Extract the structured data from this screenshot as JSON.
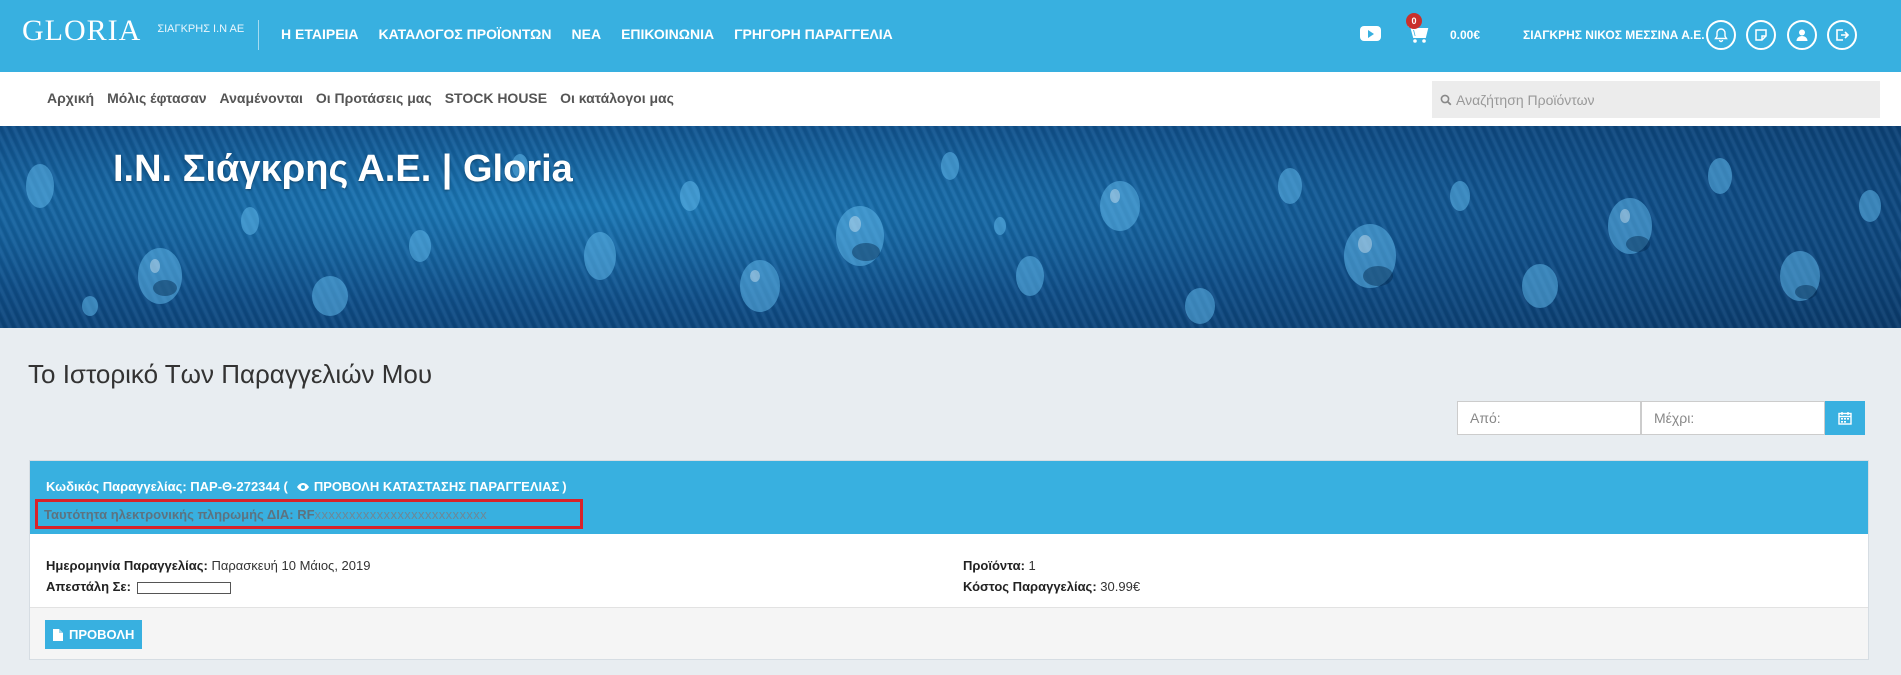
{
  "header": {
    "logo_text": "GLORIA",
    "logo_subtitle": "ΣΙΑΓΚΡΗΣ Ι.Ν ΑΕ",
    "nav": [
      "Η ΕΤΑΙΡΕΙΑ",
      "ΚΑΤΑΛΟΓΟΣ ΠΡΟΪΟΝΤΩΝ",
      "ΝΕΑ",
      "ΕΠΙΚΟΙΝΩΝΙΑ",
      "ΓΡΗΓΟΡΗ ΠΑΡΑΓΓΕΛΙΑ"
    ],
    "cart_count": "0",
    "cart_total": "0.00€",
    "username": "ΣΙΑΓΚΡΗΣ ΝΙΚΟΣ ΜΕΣΣΙΝΑ Α.Ε.",
    "icons": [
      "youtube-icon",
      "cart-icon",
      "bell-icon",
      "note-icon",
      "user-icon",
      "logout-icon"
    ]
  },
  "subnav": {
    "links": [
      "Αρχική",
      "Μόλις έφτασαν",
      "Αναμένονται",
      "Οι Προτάσεις μας",
      "STOCK HOUSE",
      "Οι κατάλογοι μας"
    ],
    "search_placeholder": "Αναζήτηση Προϊόντων"
  },
  "hero": {
    "title": "Ι.Ν. Σιάγκρης Α.Ε. | Gloria"
  },
  "page": {
    "heading": "Το Ιστορικό Των Παραγγελιών Μου",
    "from_placeholder": "Από:",
    "to_placeholder": "Μέχρι:"
  },
  "order": {
    "code_label": "Κωδικός Παραγγελίας: ΠΑΡ-Θ-272344 (",
    "status_link": "ΠΡΟΒΟΛΗ ΚΑΤΑΣΤΑΣΗΣ ΠΑΡΑΓΓΕΛΙΑΣ",
    "close_paren": ")",
    "payment_label": "Ταυτότητα ηλεκτρονικής πληρωμής ΔΙΑ: RF",
    "payment_mask": "xxxxxxxxxxxxxxxxxxxxxxxxx",
    "date_label": "Ημερομηνία Παραγγελίας:",
    "date_value": "Παρασκευή 10 Μάιος, 2019",
    "shipped_label": "Απεστάλη Σε:",
    "products_label": "Προϊόντα:",
    "products_value": "1",
    "cost_label": "Κόστος Παραγγελίας:",
    "cost_value": "30.99€",
    "view_button": "ΠΡΟΒΟΛΗ"
  },
  "colors": {
    "brand_blue": "#38b0e0",
    "highlight_red": "#d9222a",
    "badge_red": "#c9302c"
  }
}
